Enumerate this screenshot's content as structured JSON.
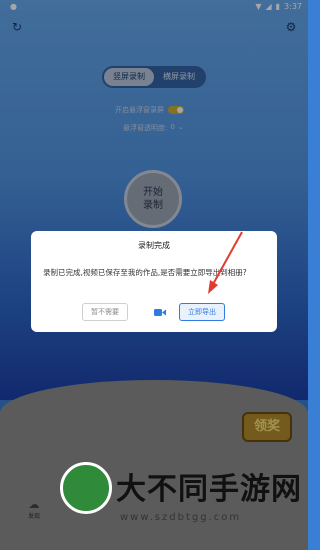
{
  "status_bar": {
    "time": "3:37",
    "left_icon": "notification-icon"
  },
  "header": {
    "left_icon": "refresh-icon",
    "right_icon": "settings-icon"
  },
  "mode_tabs": [
    {
      "label": "竖屏录制",
      "active": true
    },
    {
      "label": "横屏录制",
      "active": false
    }
  ],
  "floating_window": {
    "label": "开启悬浮窗录屏",
    "enabled": true
  },
  "opacity": {
    "label": "悬浮窗透明度:",
    "value": "0"
  },
  "start_button": {
    "line1": "开始",
    "line2": "录制"
  },
  "dialog": {
    "title": "录制完成",
    "message": "录制已完成,视频已保存至我的作品,是否需要立即导出到相册?",
    "cancel_label": "暂不需要",
    "export_label": "立即导出"
  },
  "reward_badge": {
    "label": "领奖"
  },
  "bottom_nav": {
    "label": "发现"
  },
  "watermark": {
    "text": "大不同手游网",
    "url": "www.szdbtgg.com"
  },
  "colors": {
    "accent": "#2f7be0",
    "toggle": "#c8b12b"
  }
}
